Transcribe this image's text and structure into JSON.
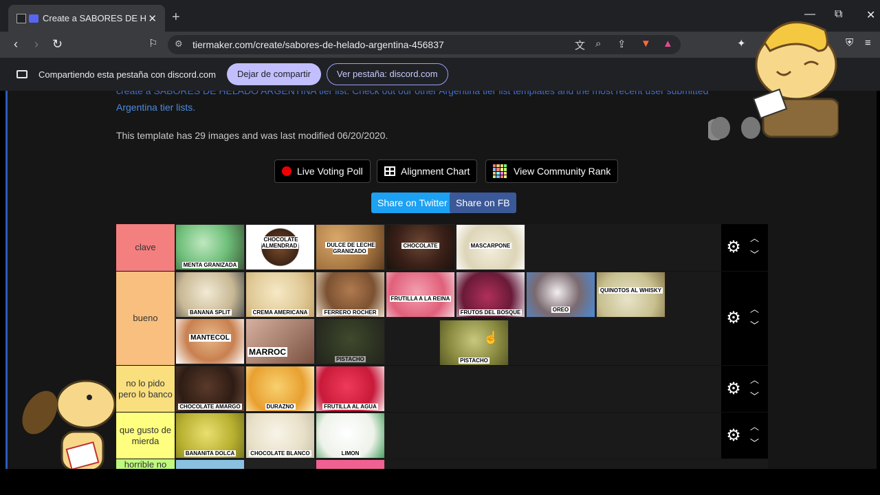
{
  "browser": {
    "tab_title": "Create a SABORES DE HELADO ARGENTINA Tier List",
    "new_tab": "+",
    "url": "tiermaker.com/create/sabores-de-helado-argentina-456837",
    "minimize": "—",
    "restore": "⧉",
    "close": "✕"
  },
  "sharebar": {
    "text": "Compartiendo esta pestaña con discord.com",
    "stop_label": "Dejar de compartir",
    "view_label": "Ver pestaña: discord.com"
  },
  "page": {
    "cut_text": "create a SABORES DE HELADO ARGENTINA tier list. Check out our other Argentina tier list templates and the most recent user submitted",
    "link_text": "Argentina tier lists.",
    "info_text": "This template has 29 images and was last modified 06/20/2020.",
    "buttons": {
      "live_voting": "Live Voting Poll",
      "alignment": "Alignment Chart",
      "community": "View Community Rank",
      "twitter": "Share on Twitter",
      "fb": "Share on FB"
    },
    "tiers": [
      {
        "label": "clave",
        "color": "#f47f7f",
        "items": [
          "MENTA GRANIZADA",
          "CHOCOLATE ALMENDRAD",
          "DULCE DE LECHE GRANIZADO",
          "CHOCOLATE",
          "MASCARPONE"
        ]
      },
      {
        "label": "bueno",
        "color": "#f8bf7f",
        "items": [
          "BANANA SPLIT",
          "CREMA AMERICANA",
          "FERRERO ROCHER",
          "FRUTILLA A LA REINA",
          "FRUTOS DEL BOSQUE",
          "OREO",
          "QUINOTOS AL WHISKY",
          "MANTECOL",
          "MARROC",
          "PISTACHO"
        ]
      },
      {
        "label": "no lo pido pero lo banco",
        "color": "#fadf7f",
        "items": [
          "CHOCOLATE AMARGO",
          "DURAZNO",
          "FRUTILLA AL AGUA"
        ]
      },
      {
        "label": "que gusto de mierda",
        "color": "#fefe7f",
        "items": [
          "BANANITA DOLCA",
          "CHOCOLATE BLANCO",
          "LIMON"
        ]
      },
      {
        "label": "horrible no",
        "color": "#bff97f",
        "items": []
      }
    ],
    "dragging_item": "PISTACHO"
  },
  "colors": {
    "accent": "#2d5bbf",
    "twitter": "#1da1f2",
    "facebook": "#3b5998"
  }
}
